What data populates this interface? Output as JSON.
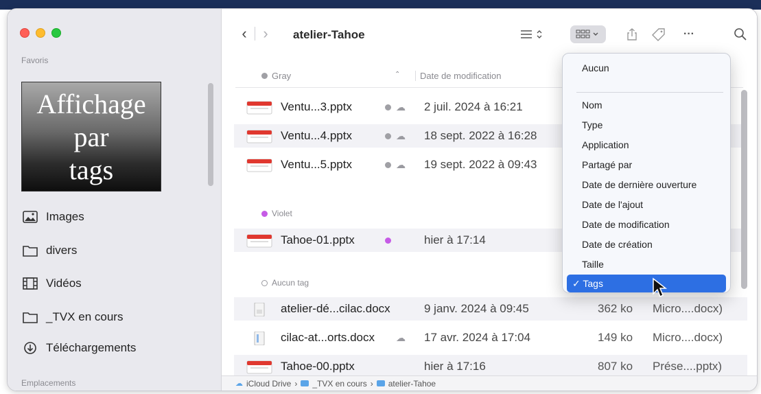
{
  "window": {
    "title": "atelier-Tahoe"
  },
  "sidebar": {
    "favorites_label": "Favoris",
    "locations_label": "Emplacements",
    "overlay_lines": [
      "Affichage",
      "par",
      "tags"
    ],
    "items": [
      {
        "label": "Images",
        "icon": "photo-icon"
      },
      {
        "label": "divers",
        "icon": "folder-icon"
      },
      {
        "label": "Vidéos",
        "icon": "film-icon"
      },
      {
        "label": "_TVX en cours",
        "icon": "folder-icon"
      },
      {
        "label": "Téléchargements",
        "icon": "download-icon"
      }
    ]
  },
  "toolbar": {
    "back": "‹",
    "forward": "›",
    "list_view_icon": "list-view-icon",
    "group_icon": "group-by-icon",
    "share_icon": "share-icon",
    "tag_icon": "tag-icon",
    "more": "···",
    "search_icon": "search-icon"
  },
  "columns": {
    "name": "Gray",
    "date": "Date de modification"
  },
  "groups": {
    "gray": "Gray",
    "violet": "Violet",
    "none": "Aucun tag"
  },
  "files": [
    {
      "name": "Ventu...3.pptx",
      "date": "2 juil. 2024 à 16:21",
      "size": "",
      "kind": ""
    },
    {
      "name": "Ventu...4.pptx",
      "date": "18 sept. 2022 à 16:28",
      "size": "",
      "kind": ""
    },
    {
      "name": "Ventu...5.pptx",
      "date": "19 sept. 2022 à 09:43",
      "size": "",
      "kind": ""
    },
    {
      "name": "Tahoe-01.pptx",
      "date": "hier à 17:14",
      "size": "",
      "kind": ""
    },
    {
      "name": "atelier-dé...cilac.docx",
      "date": "9 janv. 2024 à 09:45",
      "size": "362 ko",
      "kind": "Micro....docx)"
    },
    {
      "name": "cilac-at...orts.docx",
      "date": "17 avr. 2024 à 17:04",
      "size": "149 ko",
      "kind": "Micro....docx)"
    },
    {
      "name": "Tahoe-00.pptx",
      "date": "hier à 17:16",
      "size": "807 ko",
      "kind": "Prése....pptx)"
    }
  ],
  "pathbar": [
    "iCloud Drive",
    "_TVX en cours",
    "atelier-Tahoe"
  ],
  "menu": {
    "items": [
      "Aucun",
      "Nom",
      "Type",
      "Application",
      "Partagé par",
      "Date de dernière ouverture",
      "Date de l'ajout",
      "Date de modification",
      "Date de création",
      "Taille",
      "Tags"
    ],
    "checked": "✓",
    "selected_index": 10,
    "accent": "#2d6fe3"
  },
  "colors": {
    "tag_gray": "#a0a0a5",
    "tag_violet": "#c65be6",
    "pptx_red": "#e0382f"
  }
}
